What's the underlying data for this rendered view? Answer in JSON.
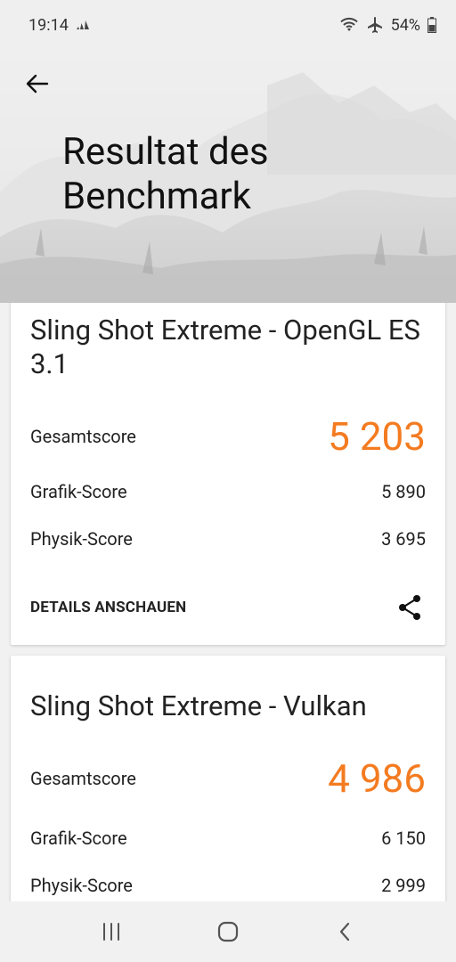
{
  "status": {
    "time": "19:14",
    "battery": "54%"
  },
  "header": {
    "title": "Resultat des Benchmark"
  },
  "cards": [
    {
      "title": "Sling Shot Extreme - OpenGL ES 3.1",
      "total_label": "Gesamtscore",
      "total_value": "5 203",
      "graphics_label": "Grafik-Score",
      "graphics_value": "5 890",
      "physics_label": "Physik-Score",
      "physics_value": "3 695",
      "details_label": "DETAILS ANSCHAUEN"
    },
    {
      "title": "Sling Shot Extreme - Vulkan",
      "total_label": "Gesamtscore",
      "total_value": "4 986",
      "graphics_label": "Grafik-Score",
      "graphics_value": "6 150",
      "physics_label": "Physik-Score",
      "physics_value": "2 999"
    }
  ],
  "colors": {
    "accent": "#f47b20"
  }
}
